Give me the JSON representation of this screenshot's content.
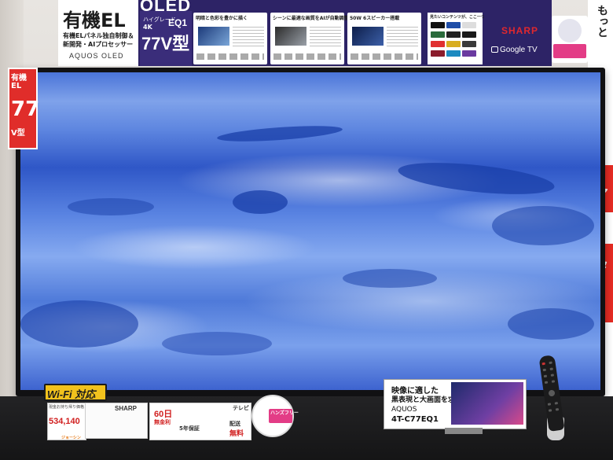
{
  "banner": {
    "oled_word": "OLED",
    "title": "有機EL",
    "subtitle_line1": "有機ELパネル独自制御＆",
    "subtitle_line2": "新開発・AIプロセッサー",
    "brand_series": "AQUOS OLED",
    "grade_label": "ハイグレード",
    "resolution": "4K",
    "model_short": "EQ1",
    "size_label": "77V型",
    "features": [
      {
        "title": "明暗と色彩を豊かに描く"
      },
      {
        "title": "シーンに最適な画質をAIが自動調整"
      },
      {
        "title": "50W 6スピーカー搭載"
      }
    ],
    "apps_title": "見たいコンテンツが、ここ一つ",
    "maker": "SHARP",
    "platform": "Google TV"
  },
  "left_tag": {
    "line1": "有機",
    "line2": "EL",
    "size": "77",
    "unit": "V型"
  },
  "right_poster": {
    "top_text": "もっと",
    "mid_text": "ア",
    "low_text": "タ"
  },
  "shelf": {
    "wifi": "Wi-Fi",
    "wifi_suffix": "対応",
    "price_header": "現金お持ち帰り価格",
    "price": "534,140",
    "price_shop": "ジョーシン",
    "sharp_label": "SHARP",
    "warranty_days": "60日",
    "warranty_free": "無金利",
    "warranty_years": "5年保証",
    "tv_label": "テレビ",
    "delivery": "配送",
    "free_label": "無料",
    "badge_text": "ハンズフリー"
  },
  "model_card": {
    "line1": "映像に適した",
    "line2": "黒表現と大画面を求める貴方に",
    "series": "AQUOS",
    "model": "4T-C77EQ1"
  },
  "colors": {
    "banner_bg": "#2d2366",
    "sharp_red": "#e0282e",
    "tag_red": "#e02d2a",
    "wifi_yellow": "#f2c21d",
    "screen_blue": "#4a74d8"
  }
}
